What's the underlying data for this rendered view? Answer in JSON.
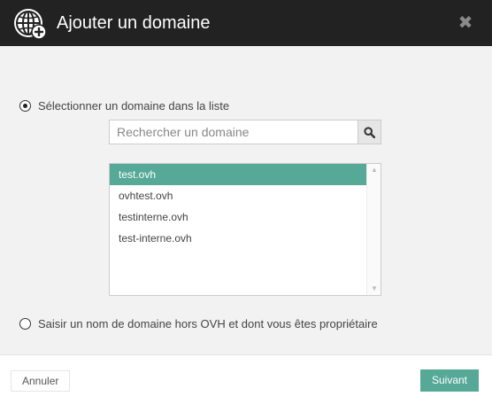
{
  "dialog": {
    "title": "Ajouter un domaine",
    "close_symbol": "✖",
    "icon": "globe-add-icon"
  },
  "options": {
    "select_label": "Sélectionner un domaine dans la liste",
    "select_checked": true,
    "external_label": "Saisir un nom de domaine hors OVH et dont vous êtes propriétaire",
    "external_checked": false
  },
  "search": {
    "placeholder": "Rechercher un domaine",
    "value": "",
    "icon": "search-icon"
  },
  "domains": {
    "items": [
      "test.ovh",
      "ovhtest.ovh",
      "testinterne.ovh",
      "test-interne.ovh"
    ],
    "selected": "test.ovh"
  },
  "footer": {
    "cancel_label": "Annuler",
    "next_label": "Suivant"
  },
  "colors": {
    "accent": "#56a897",
    "header_bg": "#222222",
    "body_bg": "#f2f2f2"
  }
}
